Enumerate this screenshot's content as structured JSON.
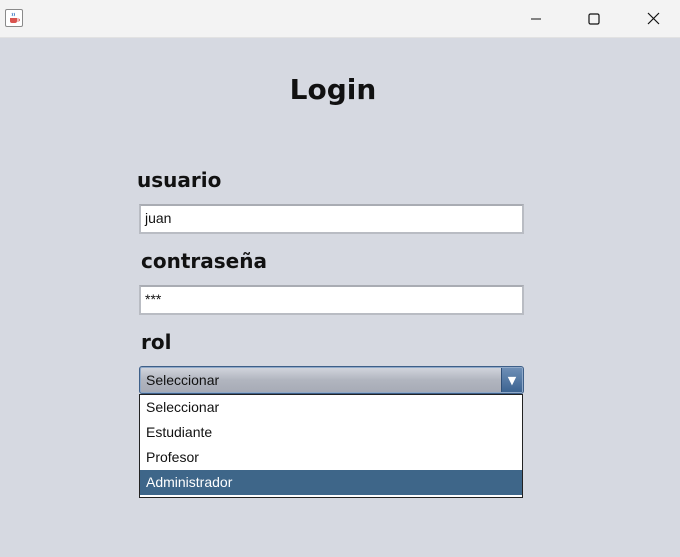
{
  "window": {
    "icons": {
      "app": "java-cup-icon",
      "minimize": "minimize-icon",
      "maximize": "maximize-icon",
      "close": "close-icon"
    }
  },
  "form": {
    "title": "Login",
    "usuario": {
      "label": "usuario",
      "value": "juan"
    },
    "contrasena": {
      "label": "contraseña",
      "value": "***"
    },
    "rol": {
      "label": "rol",
      "selected": "Seleccionar",
      "options": [
        "Seleccionar",
        "Estudiante",
        "Profesor",
        "Administrador"
      ],
      "highlighted": "Administrador"
    }
  },
  "colors": {
    "background": "#d6d9e1",
    "highlight": "#3e6689",
    "combo_border": "#3e5f88"
  }
}
